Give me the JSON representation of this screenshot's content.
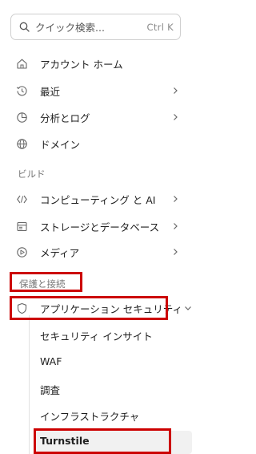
{
  "search": {
    "placeholder": "クイック検索...",
    "shortcut": "Ctrl K"
  },
  "nav": {
    "account_home": "アカウント ホーム",
    "recent": "最近",
    "analytics_logs": "分析とログ",
    "domains": "ドメイン"
  },
  "sections": {
    "build": "ビルド",
    "protect_connect": "保護と接続"
  },
  "build_items": {
    "compute_ai": "コンピューティング と AI",
    "storage_db": "ストレージとデータベース",
    "media": "メディア"
  },
  "app_security": {
    "label": "アプリケーション セキュリティ",
    "children": {
      "insights": "セキュリティ インサイト",
      "waf": "WAF",
      "investigate": "調査",
      "infrastructure": "インフラストラクチャ",
      "turnstile": "Turnstile"
    }
  },
  "colors": {
    "highlight": "#cc0000",
    "active_bg": "#f1f1f1"
  }
}
